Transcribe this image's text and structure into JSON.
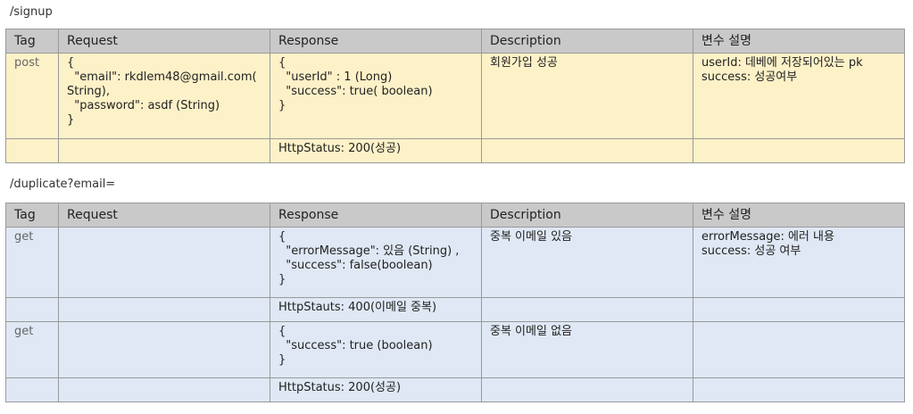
{
  "section1": {
    "path": "/signup",
    "headers": [
      "Tag",
      "Request",
      "Response",
      "Description",
      "변수 설명"
    ],
    "rows": [
      {
        "tag": "post",
        "request": "{\n  \"email\": rkdlem48@gmail.com(\nString),\n  \"password\": asdf (String)\n}",
        "response": "{\n  \"userId\" : 1 (Long)\n  \"success\": true( boolean)\n}",
        "description": "회원가입 성공",
        "variables": "userId: 데베에 저장되어있는 pk\nsuccess: 성공여부"
      },
      {
        "tag": "",
        "request": "",
        "response": "HttpStatus: 200(성공)",
        "description": "",
        "variables": ""
      }
    ]
  },
  "section2": {
    "path": "/duplicate?email=",
    "headers": [
      "Tag",
      "Request",
      "Response",
      "Description",
      "변수 설명"
    ],
    "rows": [
      {
        "tag": "get",
        "request": "",
        "response": "{\n  \"errorMessage\": 있음 (String) ,\n  \"success\": false(boolean)\n}",
        "description": "중복 이메일 있음",
        "variables": "errorMessage: 에러 내용\nsuccess: 성공 여부"
      },
      {
        "tag": "",
        "request": "",
        "response": "HttpStauts: 400(이메일 중복)",
        "description": "",
        "variables": ""
      },
      {
        "tag": "get",
        "request": "",
        "response": "{\n  \"success\": true (boolean)\n}",
        "description": "중복 이메일 없음",
        "variables": ""
      },
      {
        "tag": "",
        "request": "",
        "response": "HttpStatus: 200(성공)",
        "description": "",
        "variables": ""
      }
    ]
  }
}
